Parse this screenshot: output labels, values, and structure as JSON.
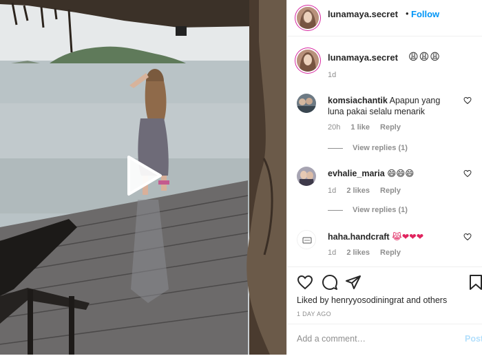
{
  "header": {
    "username": "lunamaya.secret",
    "separator": "•",
    "follow_label": "Follow"
  },
  "caption": {
    "username": "lunamaya.secret",
    "emojis": "😩😩😩",
    "time": "1d"
  },
  "comments": [
    {
      "username": "komsiachantik",
      "text": "Apapun yang luna pakai selalu menarik",
      "time": "20h",
      "likes": "1 like",
      "reply_label": "Reply",
      "view_replies": "View replies (1)"
    },
    {
      "username": "evhalie_maria",
      "text": "😄😄😄",
      "time": "1d",
      "likes": "2 likes",
      "reply_label": "Reply",
      "view_replies": "View replies (1)"
    },
    {
      "username": "haha.handcraft",
      "text": "😹❤❤❤",
      "time": "1d",
      "likes": "2 likes",
      "reply_label": "Reply"
    }
  ],
  "actions": {
    "liked_by": "Liked by henryyosodiningrat and others",
    "posted_ago": "1 DAY AGO"
  },
  "add_comment": {
    "placeholder": "Add a comment…",
    "post_label": "Post"
  },
  "icons": {
    "play": "play-icon",
    "like": "heart-icon",
    "comment": "comment-icon",
    "share": "paper-plane-icon",
    "save": "bookmark-icon"
  },
  "colors": {
    "follow": "#0095f6",
    "post_disabled": "#b2dffc",
    "muted": "#8e8e8e",
    "text": "#262626",
    "story_ring": "#d6249f"
  }
}
